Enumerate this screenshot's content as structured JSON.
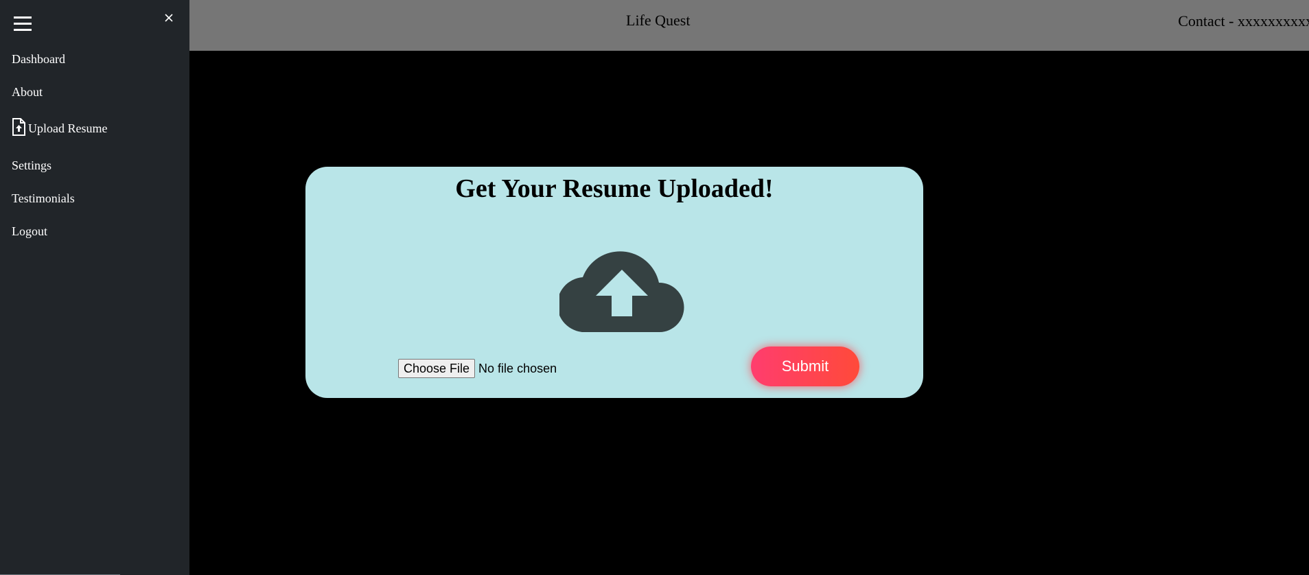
{
  "app": {
    "title": "Life Quest",
    "contact": "Contact - xxxxxxxxxx"
  },
  "sidebar": {
    "menu_icon": "hamburger-icon",
    "close_icon": "close-icon",
    "items": [
      {
        "label": "Dashboard"
      },
      {
        "label": "About"
      },
      {
        "label": "Upload Resume",
        "icon": "file-upload-icon"
      },
      {
        "label": "Settings"
      },
      {
        "label": "Testimonials"
      },
      {
        "label": "Logout"
      }
    ]
  },
  "upload": {
    "heading": "Get Your Resume Uploaded!",
    "icon": "cloud-upload-icon",
    "choose_file_label": "Choose File",
    "no_file_text": "No file chosen",
    "submit_label": "Submit"
  },
  "colors": {
    "sidebar_bg": "#212529",
    "topbar_bg": "#767676",
    "page_bg": "#000000",
    "card_bg": "#b9e5e8",
    "icon_dark": "#354142",
    "submit_gradient_start": "#ff3d6e",
    "submit_gradient_end": "#ff4a3a"
  }
}
